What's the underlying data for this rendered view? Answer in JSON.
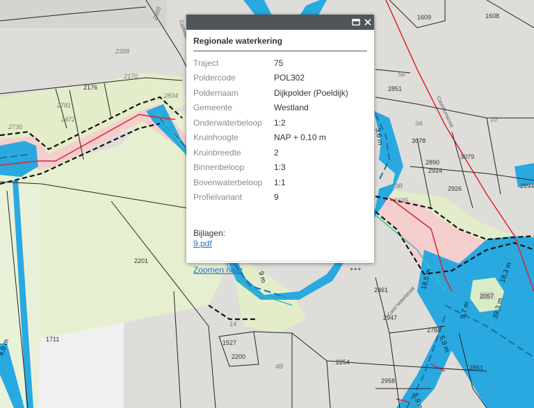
{
  "map": {
    "parcels": [
      "1608",
      "1609",
      "2988",
      "2388",
      "2170",
      "2176",
      "2834",
      "2781",
      "2472",
      "2730",
      "2851",
      "3078",
      "3079",
      "2890",
      "2924",
      "2926",
      "1635",
      "2694",
      "2201",
      "1711",
      "2461",
      "2947",
      "2788",
      "2057",
      "2861",
      "1527",
      "2200",
      "2254",
      "2958",
      "5B",
      "3A",
      "10",
      "3B",
      "4B",
      "14"
    ],
    "streets": [
      "Castellumstraat",
      "Castellumstraat",
      "Carel Nobelstraat"
    ],
    "width_labels": [
      "18,5 m",
      "18,3 m",
      "39,3 m",
      "9,7 m",
      "5,9 m",
      "5,9 m",
      "9 m",
      "4,9 m",
      "3,6 m"
    ]
  },
  "popup": {
    "title": "Regionale waterkering",
    "attributes": [
      {
        "key": "Traject",
        "value": "75"
      },
      {
        "key": "Poldercode",
        "value": "POL302"
      },
      {
        "key": "Poldernaam",
        "value": "Dijkpolder (Poeldijk)"
      },
      {
        "key": "Gemeente",
        "value": "Westland"
      },
      {
        "key": "Onderwaterbeloop",
        "value": "1:2"
      },
      {
        "key": "Kruinhoogte",
        "value": "NAP + 0,10 m"
      },
      {
        "key": "Kruinbreedte",
        "value": "2"
      },
      {
        "key": "Binnenbeloop",
        "value": "1:3"
      },
      {
        "key": "Bovenwaterbeloop",
        "value": "1:1"
      },
      {
        "key": "Profielvariant",
        "value": "9"
      }
    ],
    "attachments_label": "Bijlagen:",
    "attachment_file": "9.pdf",
    "zoom_link": "Zoomen naar",
    "more_label": "•••",
    "icons": [
      "maximize-icon",
      "close-icon"
    ]
  }
}
